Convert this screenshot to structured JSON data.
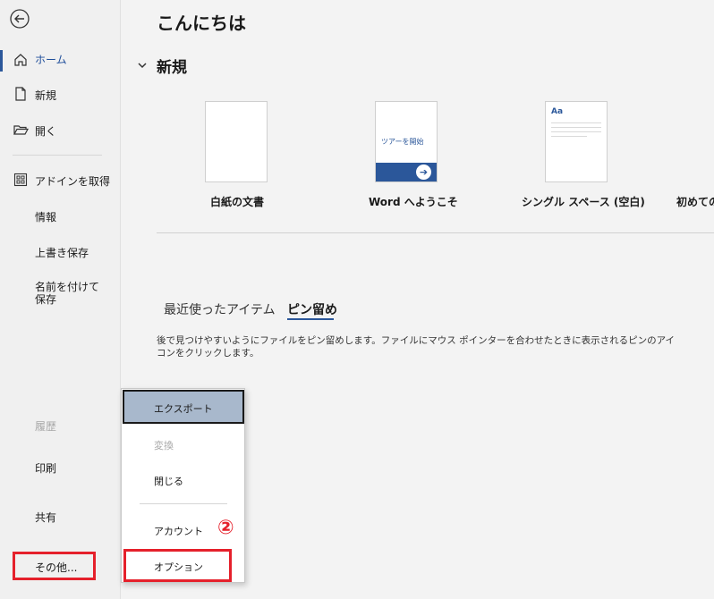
{
  "sidebar": {
    "home": "ホーム",
    "new": "新規",
    "open": "開く",
    "get_addins": "アドインを取得",
    "info": "情報",
    "save": "上書き保存",
    "save_as": "名前を付けて保存",
    "history": "履歴",
    "print": "印刷",
    "share": "共有",
    "more": "その他..."
  },
  "main": {
    "greeting": "こんにちは",
    "new_section": "新規",
    "templates": [
      {
        "label": "白紙の文書"
      },
      {
        "label": "Word へようこそ",
        "thumb_text": "ツアーを開始"
      },
      {
        "label": "シングル スペース (空白)",
        "thumb_text": "Aa"
      },
      {
        "label": "初めての"
      }
    ],
    "tabs": {
      "recent": "最近使ったアイテム",
      "pinned": "ピン留め"
    },
    "pinned_description": "後で見つけやすいようにファイルをピン留めします。ファイルにマウス ポインターを合わせたときに表示されるピンのアイコンをクリックします。"
  },
  "more_menu": {
    "items": [
      "エクスポート",
      "変換",
      "閉じる",
      "アカウント",
      "オプション"
    ]
  },
  "annotation": {
    "step": "②"
  },
  "colors": {
    "accent": "#2b579a",
    "highlight": "#e5202b",
    "selected_menu": "#a8b8cc"
  }
}
